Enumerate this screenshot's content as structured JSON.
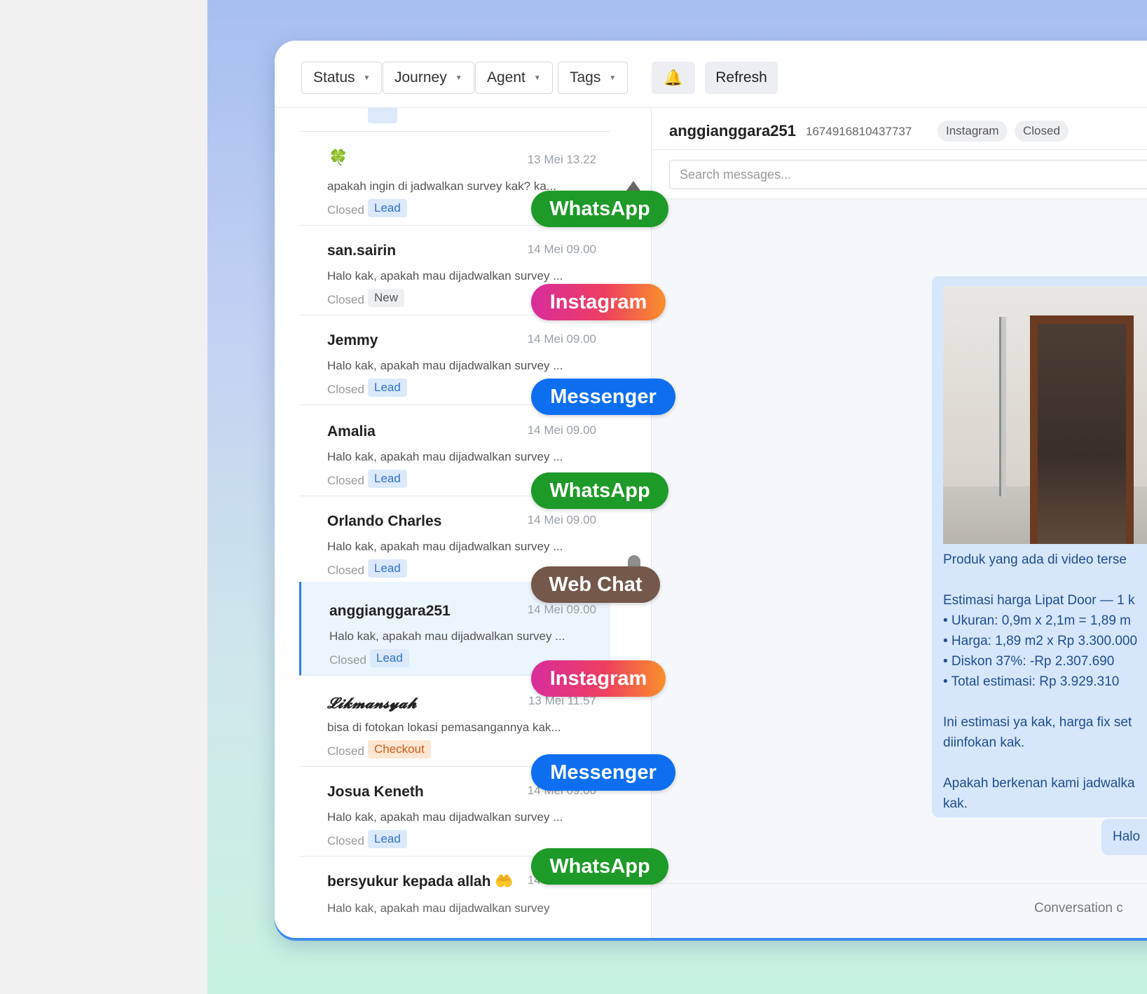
{
  "toolbar": {
    "filters": [
      {
        "label": "Status"
      },
      {
        "label": "Journey"
      },
      {
        "label": "Agent"
      },
      {
        "label": "Tags"
      }
    ],
    "refresh_label": "Refresh"
  },
  "conversations": [
    {
      "name": "",
      "time": "13 Mei 13.22",
      "message": "apakah ingin di jadwalkan survey kak? ka...",
      "status": "Closed",
      "tag": "Lead"
    },
    {
      "name": "san.sairin",
      "time": "14 Mei 09.00",
      "message": "Halo kak, apakah mau dijadwalkan survey ...",
      "status": "Closed",
      "tag": "New"
    },
    {
      "name": "Jemmy",
      "time": "14 Mei 09.00",
      "message": "Halo kak, apakah mau dijadwalkan survey ...",
      "status": "Closed",
      "tag": "Lead"
    },
    {
      "name": "Amalia",
      "time": "14 Mei 09.00",
      "message": "Halo kak, apakah mau dijadwalkan survey ...",
      "status": "Closed",
      "tag": "Lead"
    },
    {
      "name": "Orlando Charles",
      "time": "14 Mei 09.00",
      "message": "Halo kak, apakah mau dijadwalkan survey ...",
      "status": "Closed",
      "tag": "Lead"
    },
    {
      "name": "anggianggara251",
      "time": "14 Mei 09.00",
      "message": "Halo kak, apakah mau dijadwalkan survey ...",
      "status": "Closed",
      "tag": "Lead"
    },
    {
      "name": "𝓛𝓲𝓴𝓶𝓪𝓷𝓼𝔂𝓪𝓱",
      "time": "13 Mei 11.57",
      "message": "bisa di fotokan lokasi pemasangannya kak...",
      "status": "Closed",
      "tag": "Checkout"
    },
    {
      "name": "Josua Keneth",
      "time": "14 Mei 09.00",
      "message": "Halo kak, apakah mau dijadwalkan survey ...",
      "status": "Closed",
      "tag": "Lead"
    },
    {
      "name": "bersyukur kepada allah 🤲",
      "time": "14 Mei 09.00",
      "message": "",
      "status": "",
      "tag": ""
    }
  ],
  "channel_pills": [
    "WhatsApp",
    "Instagram",
    "Messenger",
    "WhatsApp",
    "Web Chat",
    "Instagram",
    "Messenger",
    "WhatsApp"
  ],
  "chat": {
    "name": "anggianggara251",
    "id": "1674916810437737",
    "channel": "Instagram",
    "status": "Closed",
    "search_placeholder": "Search messages...",
    "message_lines": "Produk yang ada di video terse\n\nEstimasi harga Lipat Door — 1 k\n• Ukuran: 0,9m x 2,1m = 1,89 m\n• Harga: 1,89 m2 x Rp 3.300.000\n• Diskon 37%: -Rp 2.307.690\n• Total estimasi: Rp 3.929.310\n\nIni estimasi ya kak, harga fix set\ndiinfokan kak.\n\nApakah berkenan kami jadwalka\nkak.",
    "reply_snippet": "Halo",
    "footer": "Conversation c"
  },
  "colors": {
    "accent": "#2f7fe3",
    "whatsapp": "#1d9a28",
    "messenger": "#0d6ff0",
    "webchat": "#74584a",
    "lead_tag": "#2f72c9",
    "checkout_tag": "#d35a12"
  }
}
